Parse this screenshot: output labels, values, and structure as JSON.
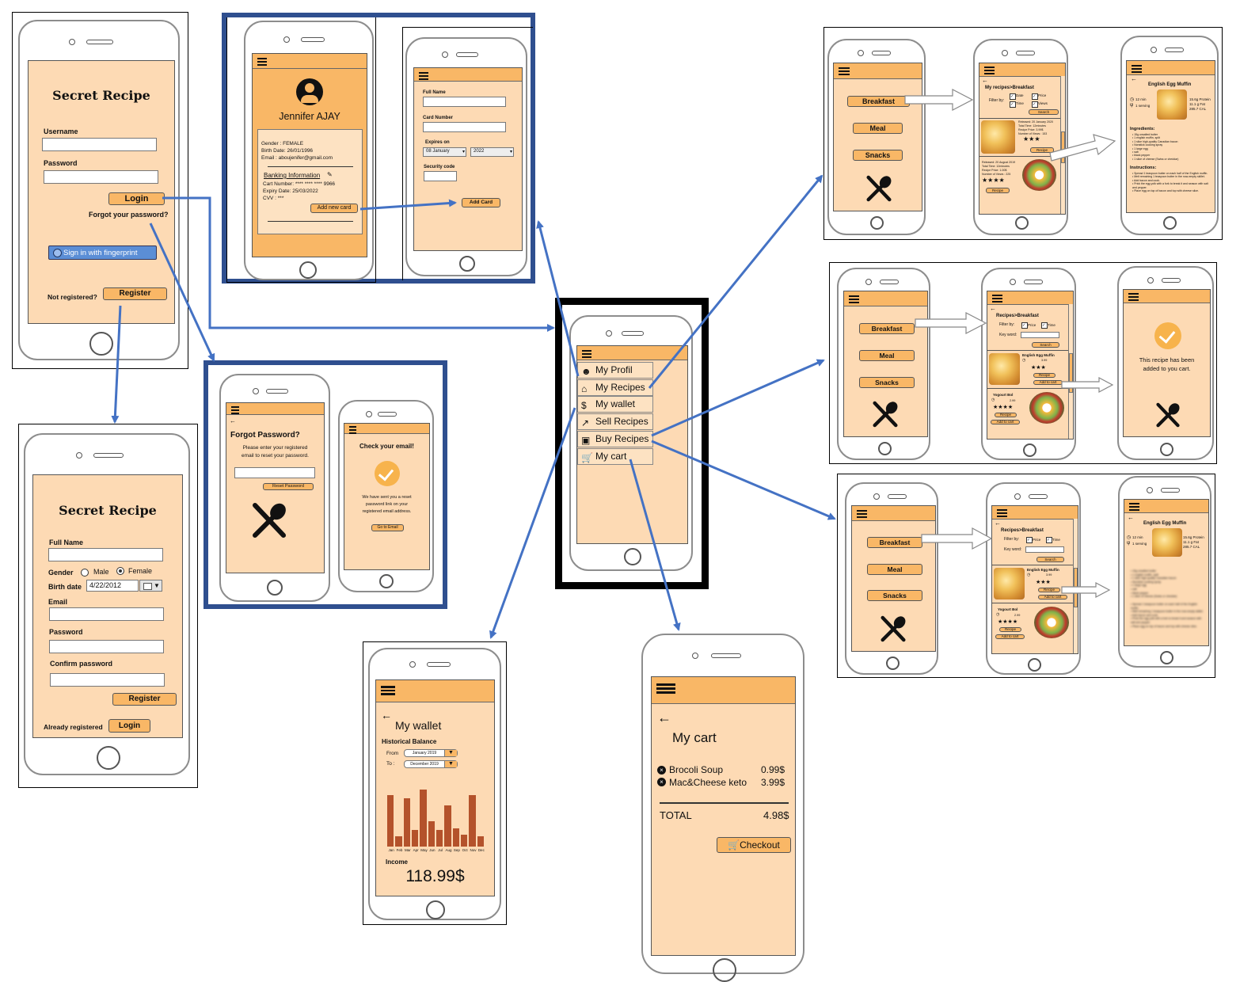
{
  "login": {
    "app_title": "Secret Recipe",
    "username_label": "Username",
    "password_label": "Password",
    "login_button": "Login",
    "forgot_password": "Forgot your password?",
    "fingerprint_button": "Sign in with fingerprint",
    "not_registered": "Not registered?",
    "register_button": "Register"
  },
  "register": {
    "app_title": "Secret Recipe",
    "full_name_label": "Full Name",
    "gender_label": "Gender",
    "male_option": "Male",
    "female_option": "Female",
    "birth_date_label": "Birth date",
    "birth_date_value": "4/22/2012",
    "email_label": "Email",
    "password_label": "Password",
    "confirm_password_label": "Confirm password",
    "register_button": "Register",
    "already_registered": "Already registered",
    "login_button": "Login"
  },
  "profile": {
    "name": "Jennifer AJAY",
    "gender": "Gender : FEMALE",
    "birth_date": "Birth Date: 26/01/1996",
    "email": "Email : aboujenifer@gmail.com",
    "banking_title": "Banking Information",
    "card_number": "Cart Number: **** **** **** 9966",
    "expiry_date": "Expiry Date: 25/03/2022",
    "cvv": "CVV : ***",
    "add_card_button": "Add new card"
  },
  "add_card": {
    "full_name_label": "Full Name",
    "card_number_label": "Card Number",
    "expires_label": "Expires on",
    "month_value": "08 January",
    "year_value": "2022",
    "security_code_label": "Security code",
    "add_card_button": "Add Card"
  },
  "forgot": {
    "title": "Forgot Password?",
    "instructions_line1": "Please enter your registered",
    "instructions_line2": "email to reset your password.",
    "reset_button": "Reset Password"
  },
  "check_email": {
    "title": "Check your email!",
    "message_line1": "We have sent you a reset",
    "message_line2": "password link on your",
    "message_line3": "registered email address.",
    "button": "Go to Email"
  },
  "main_menu": {
    "items": [
      {
        "label": "My Profil",
        "icon": "profile-icon"
      },
      {
        "label": "My Recipes",
        "icon": "home-icon"
      },
      {
        "label": "My wallet",
        "icon": "dollar-icon"
      },
      {
        "label": "Sell Recipes",
        "icon": "trend-icon"
      },
      {
        "label": "Buy Recipes",
        "icon": "shop-icon"
      },
      {
        "label": "My cart",
        "icon": "cart-icon"
      }
    ]
  },
  "wallet": {
    "title": "My wallet",
    "subtitle": "Historical Balance",
    "from_label": "From",
    "from_value": "January 2019",
    "to_label": "To :",
    "to_value": "December 2019",
    "months": [
      "Jan",
      "Feb",
      "Mar",
      "Apr",
      "May",
      "Jun",
      "Jul",
      "Aug",
      "Sep",
      "Oct",
      "Nov",
      "Dec"
    ],
    "income_label": "Income",
    "income_value": "118.99$"
  },
  "chart_data": {
    "type": "bar",
    "categories": [
      "Jan",
      "Feb",
      "Mar",
      "Apr",
      "May",
      "Jun",
      "Jul",
      "Aug",
      "Sep",
      "Oct",
      "Nov",
      "Dec"
    ],
    "values": [
      76,
      15,
      71,
      24,
      84,
      37,
      25,
      60,
      27,
      17,
      76,
      15
    ],
    "ylim": [
      0,
      100
    ]
  },
  "cart": {
    "title": "My cart",
    "items": [
      {
        "name": "Brocoli Soup",
        "price": "0.99$"
      },
      {
        "name": "Mac&Cheese keto",
        "price": "3.99$"
      }
    ],
    "total_label": "TOTAL",
    "total_value": "4.98$",
    "checkout_button": "Checkout"
  },
  "categories_screen": {
    "items": [
      "Breakfast",
      "Meal",
      "Snacks"
    ]
  },
  "my_recipes_list": {
    "title": "My recipes>Breakfast",
    "filter_label": "Filter by:",
    "filters": [
      "Date",
      "Price",
      "Time",
      "Views"
    ],
    "search_button": "Search",
    "recipe1_meta": "Released: 20 January 2020",
    "recipe1_time": "Total Time: 12minutes",
    "recipe1_price": "Recipe Price: 3.99$",
    "recipe1_views": "Number of Views : 153",
    "recipe2_meta": "Released: 20 August 2019",
    "recipe2_time": "Total Time: 12minutes",
    "recipe2_price": "Recipe Price: 1.00$",
    "recipe2_views": "Number of Views : 225",
    "recipe_button": "Recipe"
  },
  "recipe_detail": {
    "title": "English Egg Muffin",
    "time": "12 min",
    "serving": "1 serving",
    "protein": "15.6g Protein",
    "fat": "11.1 g Fat",
    "calories": "285.7 CAL",
    "ingredients_title": "Ingredients:",
    "ingredients": [
      "15g unsalted butter",
      "1 english muffin, split",
      "1 slice high-quality Canadian bacon",
      "Nonstick cooking spray",
      "1 large egg",
      "salt",
      "black pepper",
      "1 slice of cheese (Swiss or cheddar)"
    ],
    "instructions_title": "Instructions:",
    "instructions": [
      "Spread 1 teaspoon butter on each half of the English muffin.",
      "Melt remaining 1 teaspoon butter in the now-empty skillet.",
      "Add bacon and cook.",
      "Prick the egg yolk with a fork to break it and season with salt and pepper.",
      "Place egg on top of bacon and top with cheese slice."
    ]
  },
  "buy_recipes_list": {
    "title": "Recipes>Breakfast",
    "filter_label": "Filter by:",
    "filters": [
      "Price",
      "Time"
    ],
    "keyword_label": "Key word:",
    "search_button": "Search",
    "recipe1_name": "English Egg Muffin",
    "recipe1_price": "3.99",
    "recipe2_name": "Yogourt Bol",
    "recipe2_price": "2.99",
    "recipe_button": "Recipe",
    "add_to_cart_button": "Add to cart"
  },
  "added_confirmation": {
    "line1": "This recipe has been",
    "line2": "added to you cart."
  },
  "colors": {
    "screen_bg": "#fddab4",
    "topbar": "#f9b766",
    "button": "#f9b766",
    "arrow": "#4472c4",
    "frame_blue": "#2f4f8f",
    "chart_bar": "#b4522b",
    "check": "#f7b34c",
    "fingerprint_button": "#5b8ed6"
  }
}
